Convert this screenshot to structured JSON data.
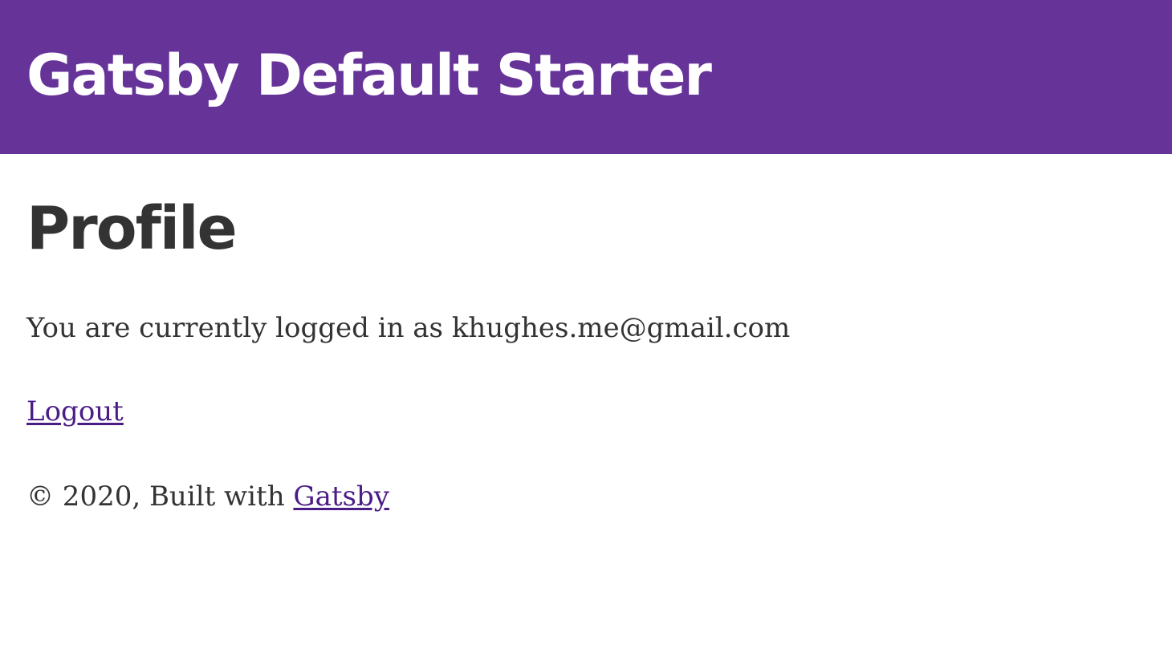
{
  "header": {
    "site_title": "Gatsby Default Starter",
    "background_color": "#663399"
  },
  "main": {
    "page_title": "Profile",
    "logged_in_prefix": "You are currently logged in as ",
    "user_email": "khughes.me@gmail.com",
    "logout_label": "Logout"
  },
  "footer": {
    "copyright_prefix": "© 2020, Built with ",
    "gatsby_link_label": "Gatsby"
  }
}
